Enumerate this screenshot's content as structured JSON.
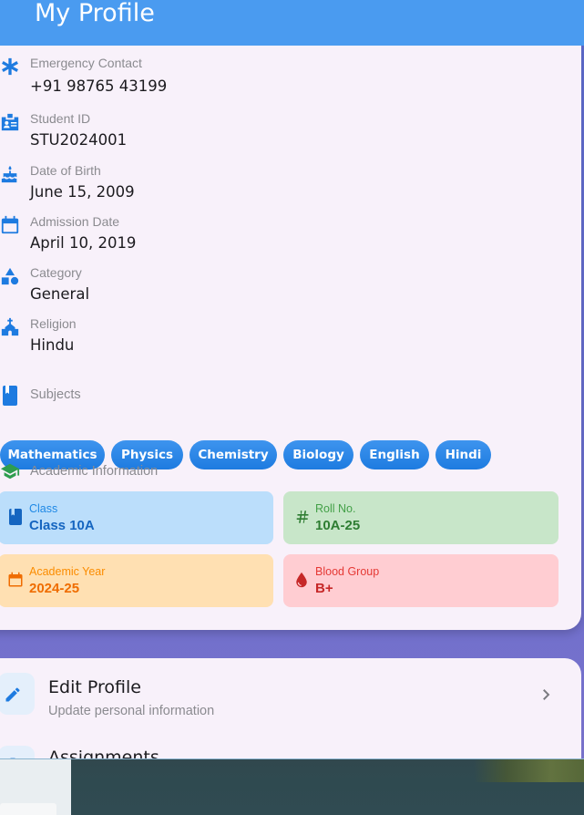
{
  "header": {
    "title": "My Profile"
  },
  "profile_fields": [
    {
      "icon": "asterisk-icon",
      "label": "Emergency Contact",
      "value": "+91 98765 43199"
    },
    {
      "icon": "id-badge-icon",
      "label": "Student ID",
      "value": "STU2024001"
    },
    {
      "icon": "cake-icon",
      "label": "Date of Birth",
      "value": "June 15, 2009"
    },
    {
      "icon": "calendar-icon",
      "label": "Admission Date",
      "value": "April 10, 2019"
    },
    {
      "icon": "category-icon",
      "label": "Category",
      "value": "General"
    },
    {
      "icon": "church-icon",
      "label": "Religion",
      "value": "Hindu"
    }
  ],
  "subjects": {
    "title": "Subjects",
    "items": [
      "Mathematics",
      "Physics",
      "Chemistry",
      "Biology",
      "English",
      "Hindi"
    ]
  },
  "academic": {
    "title": "Academic Information",
    "tiles": [
      {
        "icon": "book-icon",
        "label": "Class",
        "value": "Class 10A",
        "bg": "#bbdefb",
        "fg": "#1565c0",
        "label_color": "#1e88e5"
      },
      {
        "icon": "hash-icon",
        "label": "Roll No.",
        "value": "10A-25",
        "bg": "#c8e6c9",
        "fg": "#2e7d32",
        "label_color": "#43a047"
      },
      {
        "icon": "calendar-icon",
        "label": "Academic Year",
        "value": "2024-25",
        "bg": "#ffe0b2",
        "fg": "#ef6c00",
        "label_color": "#fb8c00"
      },
      {
        "icon": "blood-drop-icon",
        "label": "Blood Group",
        "value": "B+",
        "bg": "#ffcdd2",
        "fg": "#c62828",
        "label_color": "#e53935"
      }
    ]
  },
  "actions": [
    {
      "icon": "pencil-icon",
      "title": "Edit Profile",
      "subtitle": "Update personal information"
    },
    {
      "icon": "assignment-icon",
      "title": "Assignments",
      "subtitle": ""
    }
  ],
  "colors": {
    "primary": "#4a9bf0",
    "icon_blue": "#1e7be0",
    "academic_green": "#2e9d4f"
  }
}
